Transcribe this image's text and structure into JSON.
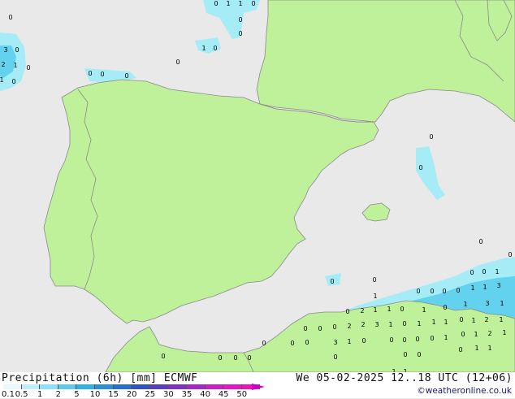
{
  "map": {
    "colors": {
      "sea": "#e9e9e9",
      "land": "#bff09a",
      "border": "#8a8a8a",
      "precip_light": "#a6ecf7",
      "precip_medium": "#62d2ef"
    },
    "labels": [
      {
        "t": "0",
        "p": [
          266,
          3
        ]
      },
      {
        "t": "1",
        "p": [
          281,
          3
        ]
      },
      {
        "t": "1",
        "p": [
          296,
          3
        ]
      },
      {
        "t": "0",
        "p": [
          312,
          3
        ]
      },
      {
        "t": "0",
        "p": [
          13,
          20
        ]
      },
      {
        "t": "0",
        "p": [
          296,
          23
        ]
      },
      {
        "t": "0",
        "p": [
          296,
          40
        ]
      },
      {
        "t": "3",
        "p": [
          7,
          60
        ]
      },
      {
        "t": "0",
        "p": [
          21,
          60
        ]
      },
      {
        "t": "1",
        "p": [
          251,
          58
        ]
      },
      {
        "t": "0",
        "p": [
          265,
          58
        ]
      },
      {
        "t": "0",
        "p": [
          219,
          75
        ]
      },
      {
        "t": "2",
        "p": [
          4,
          78
        ]
      },
      {
        "t": "1",
        "p": [
          19,
          79
        ]
      },
      {
        "t": "0",
        "p": [
          35,
          82
        ]
      },
      {
        "t": "0",
        "p": [
          111,
          89
        ]
      },
      {
        "t": "0",
        "p": [
          126,
          90
        ]
      },
      {
        "t": "0",
        "p": [
          156,
          92
        ]
      },
      {
        "t": "1",
        "p": [
          2,
          97
        ]
      },
      {
        "t": "0",
        "p": [
          17,
          99
        ]
      },
      {
        "t": "0",
        "p": [
          531,
          167
        ]
      },
      {
        "t": "0",
        "p": [
          518,
          205
        ]
      },
      {
        "t": "0",
        "p": [
          592,
          296
        ]
      },
      {
        "t": "0",
        "p": [
          628,
          312
        ]
      },
      {
        "t": "0",
        "p": [
          581,
          334
        ]
      },
      {
        "t": "0",
        "p": [
          596,
          333
        ]
      },
      {
        "t": "1",
        "p": [
          612,
          333
        ]
      },
      {
        "t": "0",
        "p": [
          409,
          345
        ]
      },
      {
        "t": "0",
        "p": [
          461,
          343
        ]
      },
      {
        "t": "0",
        "p": [
          515,
          357
        ]
      },
      {
        "t": "0",
        "p": [
          532,
          357
        ]
      },
      {
        "t": "0",
        "p": [
          547,
          357
        ]
      },
      {
        "t": "0",
        "p": [
          564,
          356
        ]
      },
      {
        "t": "1",
        "p": [
          582,
          353
        ]
      },
      {
        "t": "1",
        "p": [
          597,
          352
        ]
      },
      {
        "t": "3",
        "p": [
          614,
          350
        ]
      },
      {
        "t": "1",
        "p": [
          462,
          363
        ]
      },
      {
        "t": "1",
        "p": [
          573,
          373
        ]
      },
      {
        "t": "3",
        "p": [
          600,
          372
        ]
      },
      {
        "t": "1",
        "p": [
          618,
          372
        ]
      },
      {
        "t": "0",
        "p": [
          428,
          382
        ]
      },
      {
        "t": "2",
        "p": [
          446,
          381
        ]
      },
      {
        "t": "1",
        "p": [
          462,
          380
        ]
      },
      {
        "t": "1",
        "p": [
          479,
          379
        ]
      },
      {
        "t": "0",
        "p": [
          495,
          379
        ]
      },
      {
        "t": "1",
        "p": [
          522,
          380
        ]
      },
      {
        "t": "0",
        "p": [
          548,
          377
        ]
      },
      {
        "t": "0",
        "p": [
          568,
          392
        ]
      },
      {
        "t": "1",
        "p": [
          583,
          393
        ]
      },
      {
        "t": "2",
        "p": [
          599,
          392
        ]
      },
      {
        "t": "1",
        "p": [
          617,
          392
        ]
      },
      {
        "t": "0",
        "p": [
          376,
          403
        ]
      },
      {
        "t": "0",
        "p": [
          394,
          403
        ]
      },
      {
        "t": "0",
        "p": [
          412,
          401
        ]
      },
      {
        "t": "2",
        "p": [
          430,
          400
        ]
      },
      {
        "t": "2",
        "p": [
          447,
          398
        ]
      },
      {
        "t": "3",
        "p": [
          464,
          398
        ]
      },
      {
        "t": "1",
        "p": [
          481,
          398
        ]
      },
      {
        "t": "0",
        "p": [
          498,
          397
        ]
      },
      {
        "t": "1",
        "p": [
          516,
          397
        ]
      },
      {
        "t": "1",
        "p": [
          534,
          395
        ]
      },
      {
        "t": "1",
        "p": [
          549,
          395
        ]
      },
      {
        "t": "0",
        "p": [
          570,
          410
        ]
      },
      {
        "t": "1",
        "p": [
          586,
          410
        ]
      },
      {
        "t": "2",
        "p": [
          603,
          409
        ]
      },
      {
        "t": "1",
        "p": [
          621,
          408
        ]
      },
      {
        "t": "0",
        "p": [
          325,
          421
        ]
      },
      {
        "t": "0",
        "p": [
          360,
          421
        ]
      },
      {
        "t": "0",
        "p": [
          378,
          420
        ]
      },
      {
        "t": "3",
        "p": [
          413,
          420
        ]
      },
      {
        "t": "1",
        "p": [
          430,
          419
        ]
      },
      {
        "t": "0",
        "p": [
          448,
          418
        ]
      },
      {
        "t": "0",
        "p": [
          482,
          417
        ]
      },
      {
        "t": "0",
        "p": [
          498,
          417
        ]
      },
      {
        "t": "0",
        "p": [
          514,
          416
        ]
      },
      {
        "t": "0",
        "p": [
          532,
          415
        ]
      },
      {
        "t": "1",
        "p": [
          549,
          414
        ]
      },
      {
        "t": "0",
        "p": [
          567,
          429
        ]
      },
      {
        "t": "1",
        "p": [
          587,
          427
        ]
      },
      {
        "t": "1",
        "p": [
          603,
          427
        ]
      },
      {
        "t": "0",
        "p": [
          201,
          437
        ]
      },
      {
        "t": "0",
        "p": [
          271,
          439
        ]
      },
      {
        "t": "0",
        "p": [
          290,
          439
        ]
      },
      {
        "t": "0",
        "p": [
          307,
          439
        ]
      },
      {
        "t": "0",
        "p": [
          413,
          438
        ]
      },
      {
        "t": "0",
        "p": [
          499,
          435
        ]
      },
      {
        "t": "0",
        "p": [
          516,
          435
        ]
      },
      {
        "t": "1",
        "p": [
          485,
          456
        ]
      },
      {
        "t": "1",
        "p": [
          499,
          456
        ]
      }
    ]
  },
  "footer": {
    "title": "Precipitation (6h) [mm] ECMWF",
    "datetime": "We 05-02-2025 12..18 UTC (12+06)",
    "credit": "©weatheronline.co.uk"
  },
  "colorbar": {
    "ticks": [
      "0.1",
      "0.5",
      "1",
      "2",
      "5",
      "10",
      "15",
      "20",
      "25",
      "30",
      "35",
      "40",
      "45",
      "50"
    ],
    "colors": [
      "#e8f8fc",
      "#bdeef8",
      "#8fe0f4",
      "#5ec9ec",
      "#31b0e2",
      "#2a8fd6",
      "#2b6fce",
      "#3550c4",
      "#5a3ec2",
      "#7e32c4",
      "#a12ac6",
      "#c222c8",
      "#dd18c8",
      "#ee14b4"
    ]
  }
}
